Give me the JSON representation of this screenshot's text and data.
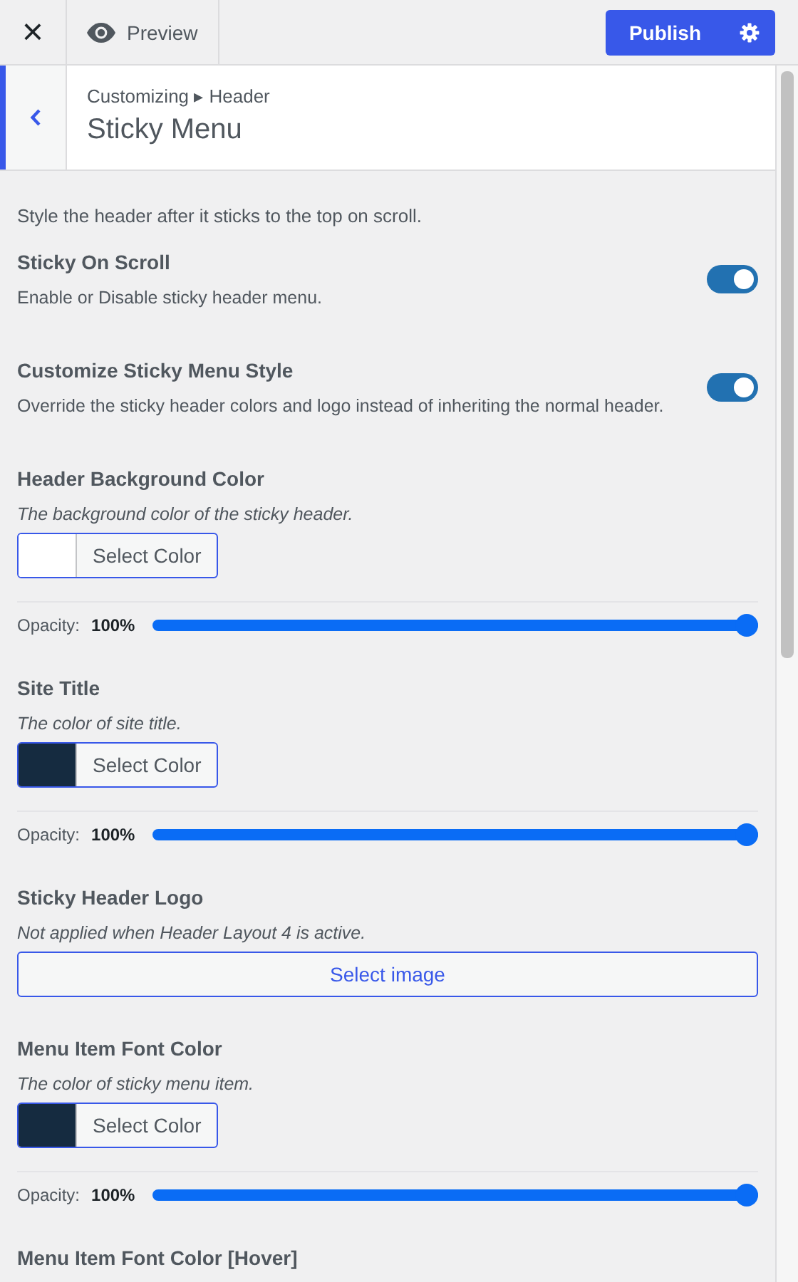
{
  "topbar": {
    "close": "×",
    "preview": "Preview",
    "publish": "Publish"
  },
  "header": {
    "breadcrumb": "Customizing ▸ Header",
    "title": "Sticky Menu"
  },
  "intro": "Style the header after it sticks to the top on scroll.",
  "sections": [
    {
      "kind": "toggle",
      "title": "Sticky On Scroll",
      "description": "Enable or Disable sticky header menu.",
      "on": true
    },
    {
      "kind": "toggle",
      "title": "Customize Sticky Menu Style",
      "description": "Override the sticky header colors and logo instead of inheriting the normal header.",
      "on": true
    },
    {
      "kind": "color",
      "title": "Header Background Color",
      "description": "The background color of the sticky header.",
      "button": "Select Color",
      "color": "#ffffff",
      "opacity_label": "Opacity:",
      "opacity_value": "100%",
      "level": 1
    },
    {
      "kind": "color",
      "title": "Site Title",
      "description": "The color of site title.",
      "button": "Select Color",
      "color": "#152b40",
      "opacity_label": "Opacity:",
      "opacity_value": "100%",
      "level": 1
    },
    {
      "kind": "image",
      "title": "Sticky Header Logo",
      "description": "Not applied when Header Layout 4 is active.",
      "button": "Select image"
    },
    {
      "kind": "color",
      "title": "Menu Item Font Color",
      "description": "The color of sticky menu item.",
      "button": "Select Color",
      "color": "#152b40",
      "opacity_label": "Opacity:",
      "opacity_value": "100%",
      "level": 1
    },
    {
      "kind": "heading",
      "title": "Menu Item Font Color [Hover]"
    }
  ]
}
